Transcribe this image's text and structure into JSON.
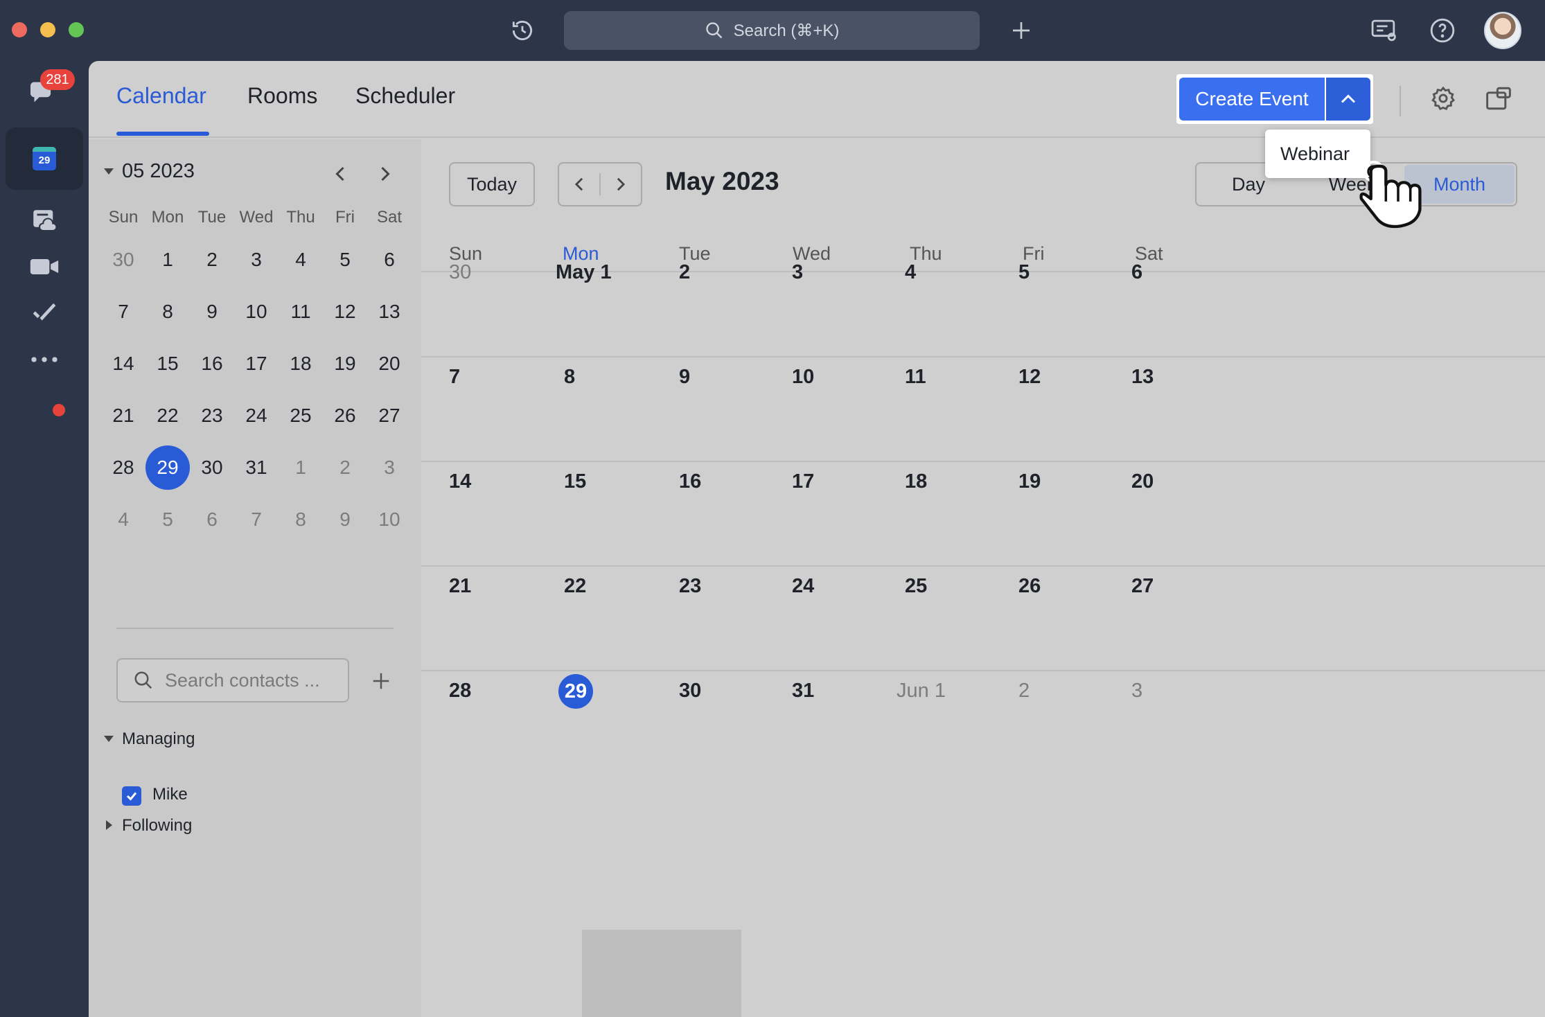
{
  "titlebar": {
    "search_placeholder": "Search (⌘+K)"
  },
  "rail": {
    "badge_count": "281",
    "calendar_icon_day": "29"
  },
  "nav": {
    "tabs": [
      "Calendar",
      "Rooms",
      "Scheduler"
    ],
    "active_tab": "Calendar",
    "create_event_label": "Create Event",
    "dropdown_item": "Webinar"
  },
  "mini_calendar": {
    "title": "05 2023",
    "weekdays": [
      "Sun",
      "Mon",
      "Tue",
      "Wed",
      "Thu",
      "Fri",
      "Sat"
    ],
    "weeks": [
      [
        "30",
        "1",
        "2",
        "3",
        "4",
        "5",
        "6"
      ],
      [
        "7",
        "8",
        "9",
        "10",
        "11",
        "12",
        "13"
      ],
      [
        "14",
        "15",
        "16",
        "17",
        "18",
        "19",
        "20"
      ],
      [
        "21",
        "22",
        "23",
        "24",
        "25",
        "26",
        "27"
      ],
      [
        "28",
        "29",
        "30",
        "31",
        "1",
        "2",
        "3"
      ],
      [
        "4",
        "5",
        "6",
        "7",
        "8",
        "9",
        "10"
      ]
    ],
    "selected": "29"
  },
  "contacts": {
    "search_placeholder": "Search contacts ...",
    "managing_label": "Managing",
    "managing_items": [
      "Mike"
    ],
    "following_label": "Following"
  },
  "toolbar": {
    "today_label": "Today",
    "month_title": "May 2023",
    "views": [
      "Day",
      "Week",
      "Month"
    ],
    "active_view": "Month"
  },
  "month_view": {
    "weekdays": [
      "Sun",
      "Mon",
      "Tue",
      "Wed",
      "Thu",
      "Fri",
      "Sat"
    ],
    "today_weekday": "Mon",
    "weeks": [
      [
        "30",
        "May 1",
        "2",
        "3",
        "4",
        "5",
        "6"
      ],
      [
        "7",
        "8",
        "9",
        "10",
        "11",
        "12",
        "13"
      ],
      [
        "14",
        "15",
        "16",
        "17",
        "18",
        "19",
        "20"
      ],
      [
        "21",
        "22",
        "23",
        "24",
        "25",
        "26",
        "27"
      ],
      [
        "28",
        "29",
        "30",
        "31",
        "Jun 1",
        "2",
        "3"
      ]
    ],
    "today": "29",
    "accent_color": "#2a5bd7"
  }
}
